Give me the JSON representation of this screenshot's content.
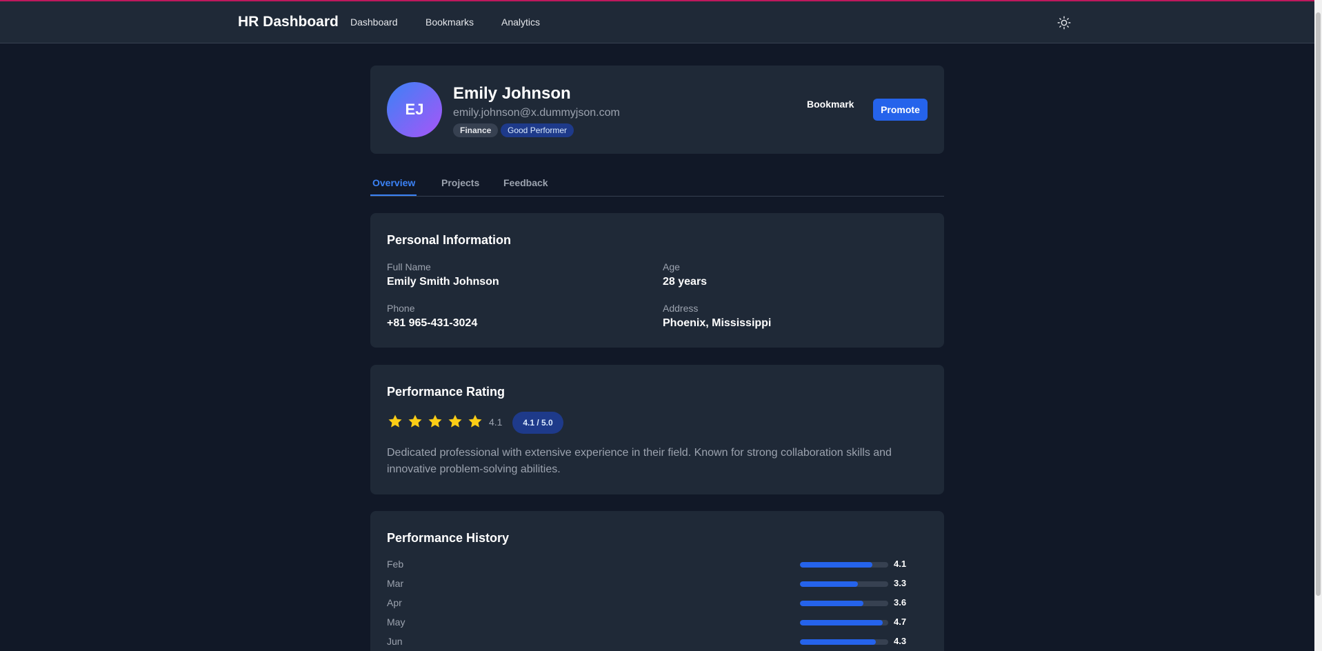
{
  "nav": {
    "brand": "HR Dashboard",
    "links": [
      "Dashboard",
      "Bookmarks",
      "Analytics"
    ],
    "theme_icon": "sun-icon"
  },
  "profile": {
    "initials": "EJ",
    "name": "Emily Johnson",
    "email": "emily.johnson@x.dummyjson.com",
    "department": "Finance",
    "performance_badge": "Good Performer",
    "bookmark_label": "Bookmark",
    "promote_label": "Promote"
  },
  "tabs": [
    {
      "label": "Overview",
      "active": true
    },
    {
      "label": "Projects",
      "active": false
    },
    {
      "label": "Feedback",
      "active": false
    }
  ],
  "personal": {
    "title": "Personal Information",
    "full_name_label": "Full Name",
    "full_name": "Emily Smith Johnson",
    "age_label": "Age",
    "age": "28 years",
    "phone_label": "Phone",
    "phone": "+81 965-431-3024",
    "address_label": "Address",
    "address": "Phoenix, Mississippi"
  },
  "rating": {
    "title": "Performance Rating",
    "stars_filled": 5,
    "value": "4.1",
    "pill": "4.1 / 5.0",
    "bio": "Dedicated professional with extensive experience in their field. Known for strong collaboration skills and innovative problem-solving abilities."
  },
  "history": {
    "title": "Performance History",
    "max": 5,
    "rows": [
      {
        "month": "Feb",
        "value": 4.1
      },
      {
        "month": "Mar",
        "value": 3.3
      },
      {
        "month": "Apr",
        "value": 3.6
      },
      {
        "month": "May",
        "value": 4.7
      },
      {
        "month": "Jun",
        "value": 4.3
      }
    ]
  },
  "colors": {
    "accent": "#2563eb",
    "star": "#facc15",
    "background": "#111827",
    "card": "#1f2937"
  }
}
